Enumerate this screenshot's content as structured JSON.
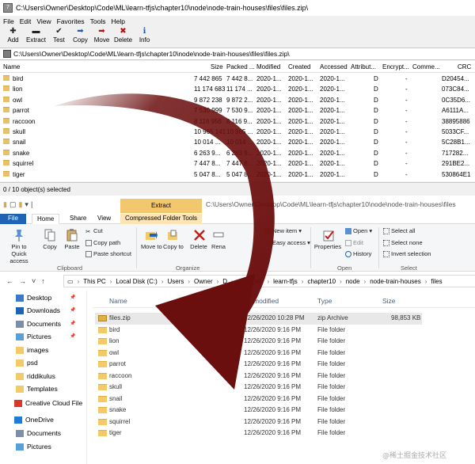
{
  "zip_window": {
    "title": "C:\\Users\\Owner\\Desktop\\Code\\ML\\learn-tfjs\\chapter10\\node\\node-train-houses\\files\\files.zip\\",
    "menu": [
      "File",
      "Edit",
      "View",
      "Favorites",
      "Tools",
      "Help"
    ],
    "toolbar": [
      {
        "label": "Add",
        "icon": "plus-icon"
      },
      {
        "label": "Extract",
        "icon": "minus-icon"
      },
      {
        "label": "Test",
        "icon": "check-icon"
      },
      {
        "label": "Copy",
        "icon": "copy-arrow-icon"
      },
      {
        "label": "Move",
        "icon": "move-arrow-icon"
      },
      {
        "label": "Delete",
        "icon": "delete-x-icon"
      },
      {
        "label": "Info",
        "icon": "info-icon"
      }
    ],
    "address": "C:\\Users\\Owner\\Desktop\\Code\\ML\\learn-tfjs\\chapter10\\node\\node-train-houses\\files\\files.zip\\",
    "columns": [
      "Name",
      "Size",
      "Packed ...",
      "Modified",
      "Created",
      "Accessed",
      "Attribut...",
      "Encrypt...",
      "Comme...",
      "CRC"
    ],
    "rows": [
      {
        "name": "bird",
        "size": "7 442 865",
        "packed": "7 442 8...",
        "modified": "2020-1...",
        "created": "2020-1...",
        "accessed": "2020-1...",
        "attr": "D",
        "enc": "-",
        "crc": "D20454..."
      },
      {
        "name": "lion",
        "size": "11 174 683",
        "packed": "11 174 ...",
        "modified": "2020-1...",
        "created": "2020-1...",
        "accessed": "2020-1...",
        "attr": "D",
        "enc": "-",
        "crc": "073C84..."
      },
      {
        "name": "owl",
        "size": "9 872 238",
        "packed": "9 872 2...",
        "modified": "2020-1...",
        "created": "2020-1...",
        "accessed": "2020-1...",
        "attr": "D",
        "enc": "-",
        "crc": "0C35D6..."
      },
      {
        "name": "parrot",
        "size": "7 530 999",
        "packed": "7 530 9...",
        "modified": "2020-1...",
        "created": "2020-1...",
        "accessed": "2020-1...",
        "attr": "D",
        "enc": "-",
        "crc": "A6111A..."
      },
      {
        "name": "raccoon",
        "size": "8 116 956",
        "packed": "8 116 9...",
        "modified": "2020-1...",
        "created": "2020-1...",
        "accessed": "2020-1...",
        "attr": "D",
        "enc": "-",
        "crc": "38895886"
      },
      {
        "name": "skull",
        "size": "10 965 141",
        "packed": "10 965 ...",
        "modified": "2020-1...",
        "created": "2020-1...",
        "accessed": "2020-1...",
        "attr": "D",
        "enc": "-",
        "crc": "5033CF..."
      },
      {
        "name": "snail",
        "size": "10 014 ...",
        "packed": "10 014 ...",
        "modified": "2020-1...",
        "created": "2020-1...",
        "accessed": "2020-1...",
        "attr": "D",
        "enc": "-",
        "crc": "5C28B1..."
      },
      {
        "name": "snake",
        "size": "6 263 9...",
        "packed": "6 263 9...",
        "modified": "2020-1...",
        "created": "2020-1...",
        "accessed": "2020-1...",
        "attr": "D",
        "enc": "-",
        "crc": "717282..."
      },
      {
        "name": "squirrel",
        "size": "7 447 8...",
        "packed": "7 447 8...",
        "modified": "2020-1...",
        "created": "2020-1...",
        "accessed": "2020-1...",
        "attr": "D",
        "enc": "-",
        "crc": "291BE2..."
      },
      {
        "name": "tiger",
        "size": "5 047 8...",
        "packed": "5 047 8...",
        "modified": "2020-1...",
        "created": "2020-1...",
        "accessed": "2020-1...",
        "attr": "D",
        "enc": "-",
        "crc": "530864E1"
      }
    ],
    "status": "0 / 10 object(s) selected"
  },
  "explorer": {
    "contextual_tab": "Extract",
    "path_text": "C:\\Users\\Owner\\Desktop\\Code\\ML\\learn-tfjs\\chapter10\\node\\node-train-houses\\files",
    "tabs": {
      "file": "File",
      "home": "Home",
      "share": "Share",
      "view": "View",
      "compressed": "Compressed Folder Tools"
    },
    "ribbon": {
      "pin": "Pin to Quick access",
      "copy": "Copy",
      "paste": "Paste",
      "cut": "Cut",
      "copy_path": "Copy path",
      "paste_shortcut": "Paste shortcut",
      "clipboard": "Clipboard",
      "move_to": "Move to",
      "copy_to": "Copy to",
      "delete": "Delete",
      "rename": "Rena",
      "organize": "Organize",
      "new_item": "New item",
      "easy_access": "Easy access",
      "properties": "Properties",
      "open": "Open",
      "edit": "Edit",
      "history": "History",
      "open_group": "Open",
      "select_all": "Select all",
      "select_none": "Select none",
      "invert_selection": "Invert selection",
      "select_group": "Select"
    },
    "breadcrumbs": [
      "This PC",
      "Local Disk (C:)",
      "Users",
      "Owner",
      "D",
      "de",
      "ML",
      "learn-tfjs",
      "chapter10",
      "node",
      "node-train-houses",
      "files"
    ],
    "nav_items": [
      {
        "label": "Desktop",
        "pinned": true
      },
      {
        "label": "Downloads",
        "pinned": true
      },
      {
        "label": "Documents",
        "pinned": true
      },
      {
        "label": "Pictures",
        "pinned": true
      },
      {
        "label": "images",
        "pinned": false
      },
      {
        "label": "psd",
        "pinned": false
      },
      {
        "label": "riddikulus",
        "pinned": false
      },
      {
        "label": "Templates",
        "pinned": false
      },
      {
        "label": "Creative Cloud File",
        "pinned": false
      },
      {
        "label": "OneDrive",
        "pinned": false
      },
      {
        "label": "Documents",
        "pinned": false
      },
      {
        "label": "Pictures",
        "pinned": false
      }
    ],
    "columns": {
      "name": "Name",
      "modified": "modified",
      "type": "Type",
      "size": "Size"
    },
    "files": [
      {
        "name": "files.zip",
        "modified": "12/26/2020 10:28 PM",
        "type": "zip Archive",
        "size": "98,853 KB",
        "selected": true
      },
      {
        "name": "bird",
        "modified": "12/26/2020 9:16 PM",
        "type": "File folder",
        "size": ""
      },
      {
        "name": "lion",
        "modified": "12/26/2020 9:16 PM",
        "type": "File folder",
        "size": ""
      },
      {
        "name": "owl",
        "modified": "12/26/2020 9:16 PM",
        "type": "File folder",
        "size": ""
      },
      {
        "name": "parrot",
        "modified": "12/26/2020 9:16 PM",
        "type": "File folder",
        "size": ""
      },
      {
        "name": "raccoon",
        "modified": "12/26/2020 9:16 PM",
        "type": "File folder",
        "size": ""
      },
      {
        "name": "skull",
        "modified": "12/26/2020 9:16 PM",
        "type": "File folder",
        "size": ""
      },
      {
        "name": "snail",
        "modified": "12/26/2020 9:16 PM",
        "type": "File folder",
        "size": ""
      },
      {
        "name": "snake",
        "modified": "12/26/2020 9:16 PM",
        "type": "File folder",
        "size": ""
      },
      {
        "name": "squirrel",
        "modified": "12/26/2020 9:16 PM",
        "type": "File folder",
        "size": ""
      },
      {
        "name": "tiger",
        "modified": "12/26/2020 9:16 PM",
        "type": "File folder",
        "size": ""
      }
    ]
  },
  "overlay": {
    "arrow_color": "#6b0e0e"
  },
  "watermark": "@稀土掘金技术社区"
}
